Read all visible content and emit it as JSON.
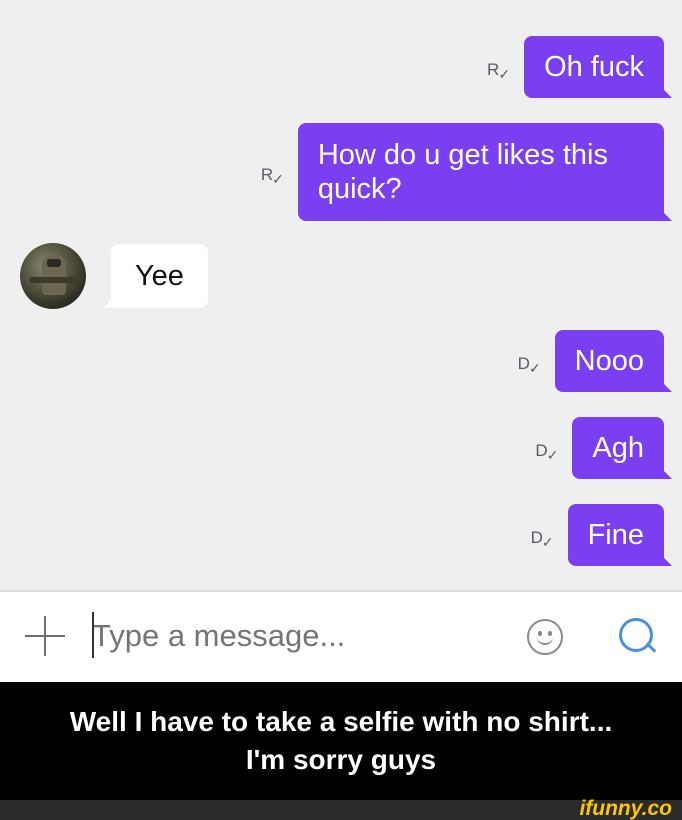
{
  "messages": [
    {
      "direction": "out",
      "status": "R",
      "text": "Oh fuck"
    },
    {
      "direction": "out",
      "status": "R",
      "text_line1": "How do u get likes this",
      "text_line2": "quick?"
    },
    {
      "direction": "in",
      "text": "Yee"
    },
    {
      "direction": "out",
      "status": "D",
      "text": "Nooo"
    },
    {
      "direction": "out",
      "status": "D",
      "text": "Agh"
    },
    {
      "direction": "out",
      "status": "D",
      "text": "Fine"
    }
  ],
  "receipt_tick": "✓",
  "composer": {
    "placeholder": "Type a message...",
    "add_icon": "plus-icon",
    "emoji_icon": "smiley-icon",
    "send_icon": "search-bubble-icon"
  },
  "caption": {
    "line1": "Well I have to take a selfie with no shirt...",
    "line2": "I'm sorry guys"
  },
  "watermark": "ifunny.co",
  "colors": {
    "outgoing_bubble": "#7b3ff2",
    "incoming_bubble": "#ffffff",
    "chat_background": "#efefef",
    "send_icon": "#4a90e2",
    "watermark": "#ffc600"
  }
}
